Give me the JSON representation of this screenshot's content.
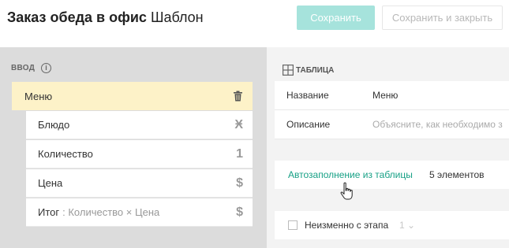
{
  "header": {
    "title_bold": "Заказ обеда в офис",
    "title_rest": "Шаблон",
    "save_label": "Сохранить",
    "save_close_label": "Сохранить и закрыть"
  },
  "input_section": {
    "label": "ВВОД",
    "info_icon": "i",
    "menu": {
      "label": "Меню",
      "icon": "trash-icon"
    },
    "fields": [
      {
        "label": "Блюдо",
        "icon": "text-icon",
        "icon_glyph": "Ӿ"
      },
      {
        "label": "Количество",
        "icon": "number-icon",
        "icon_glyph": "1"
      },
      {
        "label": "Цена",
        "icon": "currency-icon",
        "icon_glyph": "$"
      },
      {
        "label": "Итог",
        "formula": ": Количество × Цена",
        "icon": "currency-icon",
        "icon_glyph": "$"
      }
    ]
  },
  "table_section": {
    "label": "ТАБЛИЦА",
    "name_key": "Название",
    "name_value": "Меню",
    "description_key": "Описание",
    "description_placeholder": "Объясните, как необходимо з",
    "autofill_link": "Автозаполнение из таблицы",
    "autofill_count": "5 элементов",
    "unchanged_label": "Неизменно с этапа",
    "stage_value": "1 ⌄"
  },
  "colors": {
    "accent": "#16a085",
    "save_button_disabled": "#a6e3dc",
    "selected_row": "#fdf2c8",
    "left_bg": "#dcdcdc"
  }
}
